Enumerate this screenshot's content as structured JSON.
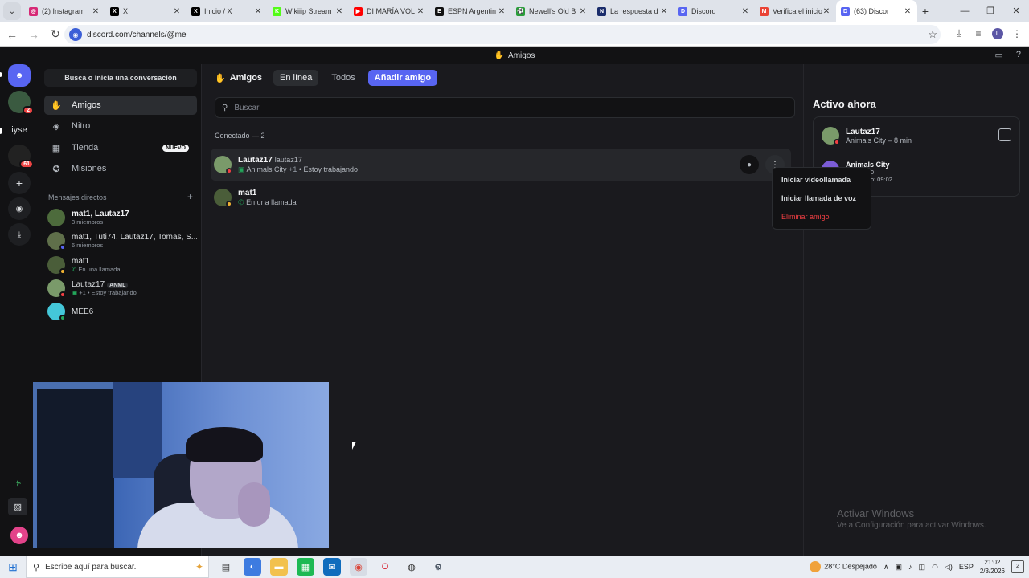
{
  "browser": {
    "tabs": [
      {
        "title": "(2) Instagram",
        "color": "#d62976",
        "glyph": "◎"
      },
      {
        "title": "X",
        "color": "#000000",
        "glyph": "X"
      },
      {
        "title": "Inicio / X",
        "color": "#000000",
        "glyph": "X"
      },
      {
        "title": "Wikiiip Stream",
        "color": "#53fc18",
        "glyph": "K"
      },
      {
        "title": "DI MARÍA VOL",
        "color": "#ff0000",
        "glyph": "▶"
      },
      {
        "title": "ESPN Argentin",
        "color": "#111111",
        "glyph": "E"
      },
      {
        "title": "Newell's Old B",
        "color": "#2a9d3a",
        "glyph": "⚽"
      },
      {
        "title": "La respuesta d",
        "color": "#1a2c6b",
        "glyph": "N"
      },
      {
        "title": "Discord",
        "color": "#5865f2",
        "glyph": "D"
      },
      {
        "title": "Verifica el inicio",
        "color": "#ea4335",
        "glyph": "M"
      },
      {
        "title": "(63) Discor",
        "color": "#5865f2",
        "glyph": "D",
        "active": true
      }
    ],
    "url": "discord.com/channels/@me",
    "profile_initial": "L"
  },
  "topbar": {
    "title": "Amigos"
  },
  "guilds": {
    "items": [
      {
        "label": "",
        "badge": ""
      },
      {
        "label": "",
        "badge": "2"
      },
      {
        "label": "iyse",
        "badge": ""
      },
      {
        "label": "",
        "badge": "61"
      }
    ]
  },
  "sidebar": {
    "search_placeholder": "Busca o inicia una conversación",
    "nav": [
      {
        "label": "Amigos",
        "icon": "wave-icon"
      },
      {
        "label": "Nitro",
        "icon": "nitro-icon"
      },
      {
        "label": "Tienda",
        "icon": "shop-icon",
        "badge": "NUEVO"
      },
      {
        "label": "Misiones",
        "icon": "quest-icon"
      }
    ],
    "dm_header": "Mensajes directos",
    "dm_add": "+",
    "dms": [
      {
        "name": "mat1, Lautaz17",
        "sub": "3 miembros",
        "bold": true
      },
      {
        "name": "mat1, Tuti74, Lautaz17, Tomas, S...",
        "sub": "6 miembros"
      },
      {
        "name": "mat1",
        "sub": "En una llamada"
      },
      {
        "name": "Lautaz17",
        "tag": "ANML",
        "sub": "+1 • Estoy trabajando"
      },
      {
        "name": "MEE6",
        "sub": ""
      }
    ]
  },
  "friends": {
    "title": "Amigos",
    "tabs": [
      "En línea",
      "Todos"
    ],
    "add_button": "Añadir amigo",
    "search_placeholder": "Buscar",
    "count_label": "Conectado — 2",
    "rows": [
      {
        "name": "Lautaz17",
        "username": "lautaz17",
        "activity": "Animals City",
        "extra": "+1",
        "status": "• Estoy trabajando"
      },
      {
        "name": "mat1",
        "username": "",
        "activity": "En una llamada",
        "extra": "",
        "status": ""
      }
    ],
    "menu": [
      "Iniciar videollamada",
      "Iniciar llamada de voz",
      "Eliminar amigo"
    ]
  },
  "active_now": {
    "title": "Activo ahora",
    "user": "Lautaz17",
    "sub": "Animals City – 8 min",
    "activity_title": "Animals City",
    "activity_line1": "s: 191/400",
    "activity_line2": "anscurrido: 09:02"
  },
  "watermark": {
    "line1": "Activar Windows",
    "line2": "Ve a Configuración para activar Windows."
  },
  "taskbar": {
    "search_placeholder": "Escribe aquí para buscar.",
    "weather": "28°C  Despejado",
    "lang": "ESP",
    "time": "21:02",
    "date": "2/3/2026",
    "notif_count": "2"
  }
}
